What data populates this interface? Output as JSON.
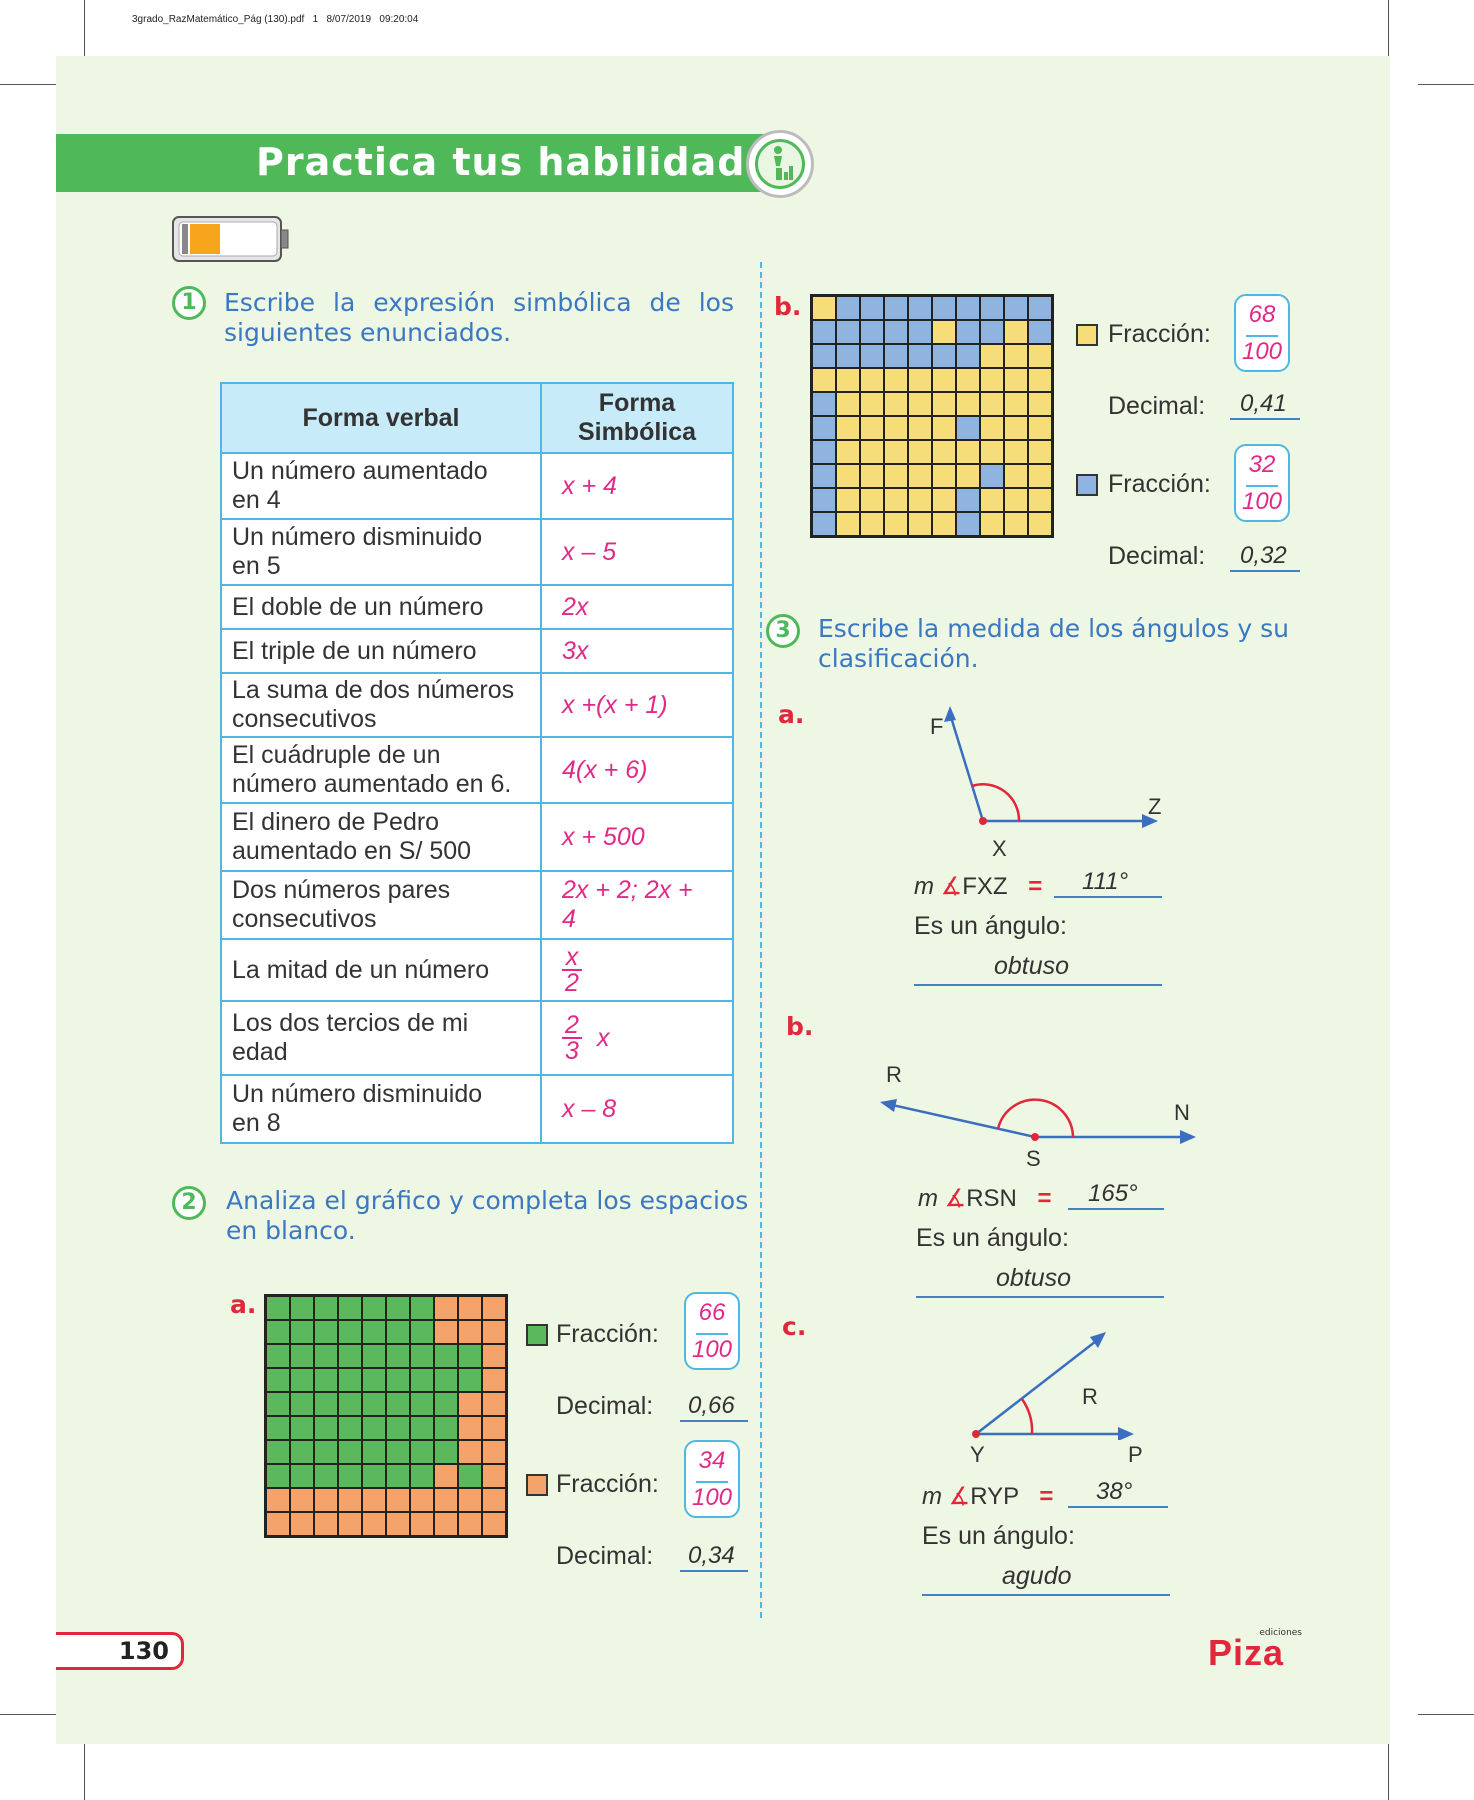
{
  "file_info": "3grado_RazMatemático_Pág (130).pdf   1   8/07/2019   09:20:04",
  "header": {
    "title": "Practica tus habilidades"
  },
  "q1": {
    "number": "1",
    "text_line1": "Escribe la expresión simbólica de los",
    "text_line2": "siguientes enunciados.",
    "table": {
      "col1_header": "Forma verbal",
      "col2_header_line1": "Forma",
      "col2_header_line2": "Simbólica",
      "rows": [
        {
          "verbal_l1": "Un número aumentado",
          "verbal_l2": "en 4",
          "symbolic": "x + 4"
        },
        {
          "verbal_l1": "Un número disminuido",
          "verbal_l2": "en 5",
          "symbolic": "x – 5"
        },
        {
          "verbal_l1": "El doble de un número",
          "verbal_l2": "",
          "symbolic": "2x"
        },
        {
          "verbal_l1": "El triple de un número",
          "verbal_l2": "",
          "symbolic": "3x"
        },
        {
          "verbal_l1": "La suma de dos números",
          "verbal_l2": "consecutivos",
          "symbolic": "x +(x + 1)"
        },
        {
          "verbal_l1": "El cuádruple de un",
          "verbal_l2": "número aumentado en 6.",
          "symbolic": "4(x + 6)"
        },
        {
          "verbal_l1": "El dinero de Pedro",
          "verbal_l2": "aumentado en S/ 500",
          "symbolic": "x + 500"
        },
        {
          "verbal_l1": "Dos números pares",
          "verbal_l2": "consecutivos",
          "symbolic": "2x + 2; 2x + 4"
        },
        {
          "verbal_l1": "La mitad de un número",
          "verbal_l2": "",
          "frac_num": "x",
          "frac_den": "2"
        },
        {
          "verbal_l1": "Los dos tercios de mi",
          "verbal_l2": "edad",
          "frac_num": "2",
          "frac_den": "3",
          "frac_suffix": "x"
        },
        {
          "verbal_l1": "Un número disminuido",
          "verbal_l2": "en 8",
          "symbolic": "x – 8"
        }
      ]
    }
  },
  "q2": {
    "number": "2",
    "text_line1": "Analiza el gráfico y completa los espacios",
    "text_line2": "en blanco.",
    "fraction_label": "Fracción:",
    "decimal_label": "Decimal:",
    "a": {
      "label": "a.",
      "green": {
        "num": "66",
        "den": "100",
        "decimal": "0,66",
        "color": "#5cb85c"
      },
      "orange": {
        "num": "34",
        "den": "100",
        "decimal": "0,34",
        "color": "#f4a46a"
      }
    },
    "b": {
      "label": "b.",
      "yellow": {
        "num": "68",
        "den": "100",
        "decimal": "0,41",
        "color": "#f7dc7a"
      },
      "blue": {
        "num": "32",
        "den": "100",
        "decimal": "0,32",
        "color": "#8fb4e0"
      }
    }
  },
  "q3": {
    "number": "3",
    "text_line1": "Escribe la medida de los ángulos y su",
    "text_line2": "clasificación.",
    "type_prompt": "Es un ángulo:",
    "m_symbol": "m",
    "angle_symbol": "∡",
    "equals": "=",
    "a": {
      "label": "a.",
      "angle_name": "FXZ",
      "measure": "111°",
      "type": "obtuso",
      "vertex": "X",
      "p1": "F",
      "p2": "Z"
    },
    "b": {
      "label": "b.",
      "angle_name": "RSN",
      "measure": "165°",
      "type": "obtuso",
      "vertex": "S",
      "p1": "R",
      "p2": "N"
    },
    "c": {
      "label": "c.",
      "angle_name": "RYP",
      "measure": "38°",
      "type": "agudo",
      "vertex": "Y",
      "p1": "R",
      "p2": "P"
    }
  },
  "footer": {
    "page_number": "130",
    "brand": "Piza",
    "brand_sub": "ediciones"
  },
  "colors": {
    "green": "#4fb95a",
    "blue_text": "#3a78c2",
    "answer_pink": "#e02a86",
    "red": "#e0283a",
    "table_border": "#4eb7e4"
  }
}
